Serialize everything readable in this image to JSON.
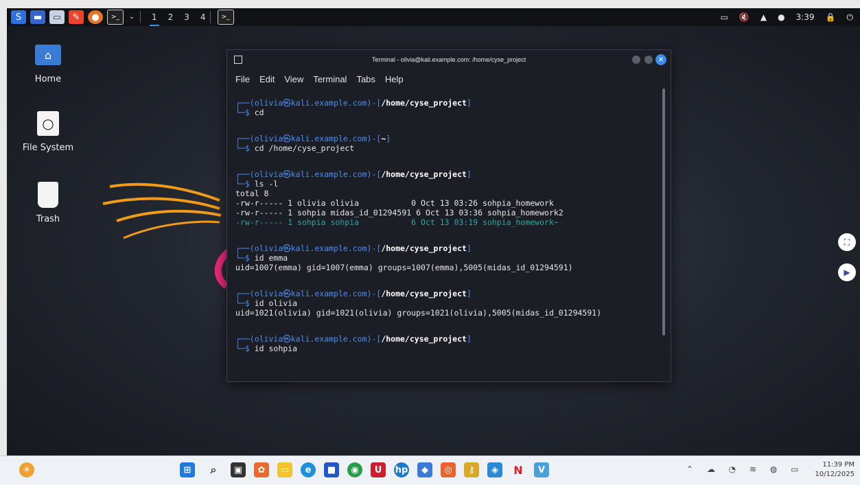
{
  "topbar": {
    "workspaces": [
      "1",
      "2",
      "3",
      "4"
    ],
    "clock": "3:39"
  },
  "desktop": {
    "icons": [
      {
        "label": "Home"
      },
      {
        "label": "File System"
      },
      {
        "label": "Trash"
      }
    ]
  },
  "terminal": {
    "title": "Terminal - olivia@kali.example.com: /home/cyse_project",
    "menu": [
      "File",
      "Edit",
      "View",
      "Terminal",
      "Tabs",
      "Help"
    ],
    "user": "olivia",
    "host": "kali.example.com",
    "blocks": [
      {
        "path": "/home/cyse_project",
        "cmd": "cd",
        "output": []
      },
      {
        "path": "~",
        "cmd": "cd /home/cyse_project",
        "output": []
      },
      {
        "path": "/home/cyse_project",
        "cmd": "ls -l",
        "output": [
          "total 8",
          "-rw-r----- 1 olivia olivia           0 Oct 13 03:26 sohpia_homework",
          "-rw-r----- 1 sohpia midas_id_01294591 6 Oct 13 03:36 sohpia_homework2",
          "-rw-r----- 1 sohpia sohpia           6 Oct 13 03:19 sohpia_homework~"
        ]
      },
      {
        "path": "/home/cyse_project",
        "cmd": "id emma",
        "output": [
          "uid=1007(emma) gid=1007(emma) groups=1007(emma),5005(midas_id_01294591)"
        ]
      },
      {
        "path": "/home/cyse_project",
        "cmd": "id olivia",
        "output": [
          "uid=1021(olivia) gid=1021(olivia) groups=1021(olivia),5005(midas_id_01294591)"
        ]
      },
      {
        "path": "/home/cyse_project",
        "cmd": "id sohpia",
        "output": []
      }
    ]
  },
  "host_taskbar": {
    "clock_time": "11:39 PM",
    "clock_date": "10/12/2025"
  },
  "colors": {
    "kali_blue": "#4f8cf0",
    "terminal_bg": "#1b1e24",
    "taskbar_bg": "#eef1f6"
  }
}
